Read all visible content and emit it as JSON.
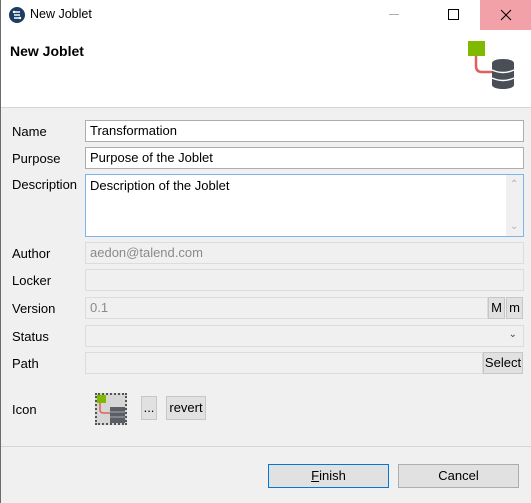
{
  "window": {
    "title": "New Joblet",
    "app_icon": "talend-studio-icon",
    "controls": [
      "minimize",
      "maximize",
      "close"
    ]
  },
  "header": {
    "title": "New Joblet",
    "icon": "joblet-icon"
  },
  "form": {
    "name": {
      "label": "Name",
      "value": "Transformation"
    },
    "purpose": {
      "label": "Purpose",
      "value": "Purpose of the Joblet"
    },
    "description": {
      "label": "Description",
      "value": "Description of the Joblet"
    },
    "author": {
      "label": "Author",
      "value": "aedon@talend.com"
    },
    "locker": {
      "label": "Locker",
      "value": ""
    },
    "version": {
      "label": "Version",
      "value": "0.1",
      "major_button": "M",
      "minor_button": "m"
    },
    "status": {
      "label": "Status",
      "value": ""
    },
    "path": {
      "label": "Path",
      "value": "",
      "select_button": "Select"
    },
    "icon": {
      "label": "Icon",
      "browse_button": "...",
      "revert_button": "revert"
    }
  },
  "footer": {
    "finish_mnemonic": "F",
    "finish_rest": "inish",
    "cancel_label": "Cancel"
  },
  "colors": {
    "close_hover": "#f1a1a7",
    "accent": "#0078d7",
    "joblet_green": "#7fba00",
    "joblet_red": "#e0605a",
    "db_gray": "#4a4f57"
  }
}
